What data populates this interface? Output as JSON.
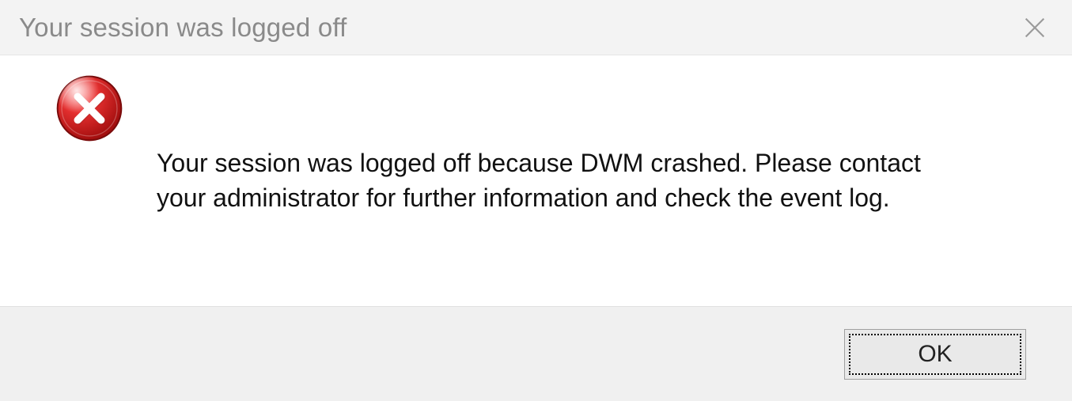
{
  "dialog": {
    "title": "Your session was logged off",
    "message": "Your session was logged off because DWM crashed. Please contact your administrator for further information and check the event log.",
    "icon": "error-icon",
    "ok_label": "OK"
  }
}
